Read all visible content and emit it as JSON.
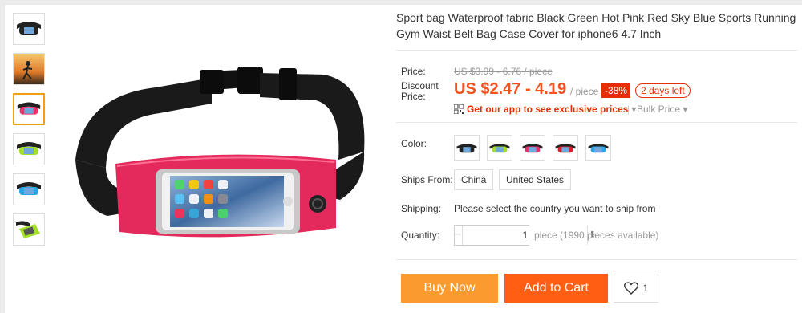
{
  "product": {
    "title": "Sport bag Waterproof fabric Black Green Hot Pink Red Sky Blue Sports Running Gym Waist Belt Bag Case Cover for iphone6 4.7 Inch"
  },
  "price": {
    "price_label": "Price:",
    "original_price": "US $3.99 - 6.76 / piece",
    "discount_label": "Discount Price:",
    "discount_price": "US $2.47 - 4.19",
    "per_unit": "/ piece",
    "discount_percent": "-38%",
    "time_left": "2 days left",
    "app_promo": "Get our app to see exclusive prices",
    "bulk_price": "Bulk Price"
  },
  "options": {
    "color_label": "Color:",
    "colors": [
      {
        "name": "black",
        "hex": "#222222"
      },
      {
        "name": "green",
        "hex": "#a4e02a"
      },
      {
        "name": "hot-pink",
        "hex": "#e8326a"
      },
      {
        "name": "red",
        "hex": "#d4232c"
      },
      {
        "name": "sky-blue",
        "hex": "#2aa7e0"
      }
    ],
    "ships_from_label": "Ships From:",
    "ships_from": [
      "China",
      "United States"
    ],
    "shipping_label": "Shipping:",
    "shipping_text": "Please select the country you want to ship from",
    "quantity_label": "Quantity:",
    "quantity_value": "1",
    "availability": "piece (1990 pieces available)"
  },
  "actions": {
    "buy_now": "Buy Now",
    "add_to_cart": "Add to Cart",
    "wishlist_count": "1"
  },
  "thumbnails": [
    {
      "name": "black",
      "hex": "#222222"
    },
    {
      "name": "runner-photo",
      "hex": "#f5a623"
    },
    {
      "name": "hot-pink",
      "hex": "#e8326a"
    },
    {
      "name": "green",
      "hex": "#a4e02a"
    },
    {
      "name": "sky-blue",
      "hex": "#2aa7e0"
    },
    {
      "name": "green-open",
      "hex": "#a4e02a"
    }
  ],
  "colors": {
    "accent_orange": "#fb9a2e",
    "cart_orange": "#ff5e13",
    "price_red": "#f4511e",
    "badge_red": "#e62e04",
    "thumb_active_border": "#f0a010"
  }
}
